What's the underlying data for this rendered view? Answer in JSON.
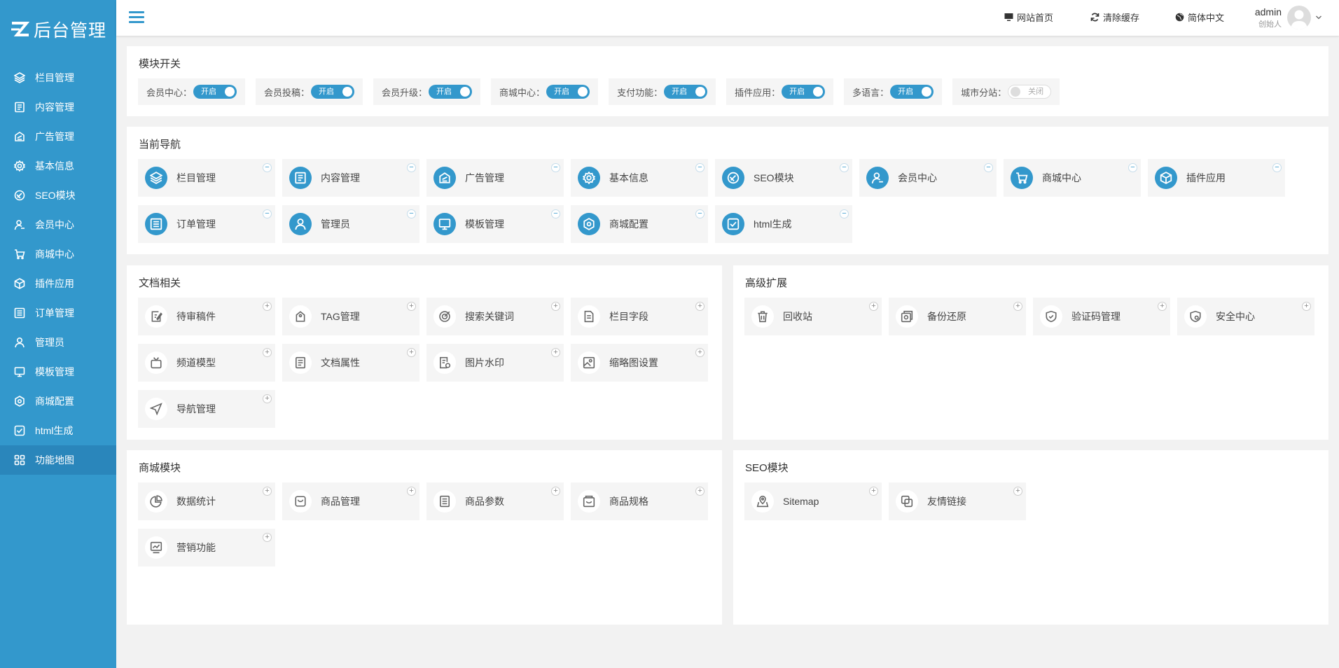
{
  "brand": {
    "logo_text": "后台管理"
  },
  "sidebar": {
    "items": [
      {
        "label": "栏目管理",
        "icon": "layers-icon"
      },
      {
        "label": "内容管理",
        "icon": "document-icon"
      },
      {
        "label": "广告管理",
        "icon": "ad-icon"
      },
      {
        "label": "基本信息",
        "icon": "gear-icon"
      },
      {
        "label": "SEO模块",
        "icon": "seo-icon"
      },
      {
        "label": "会员中心",
        "icon": "user-icon"
      },
      {
        "label": "商城中心",
        "icon": "cart-icon"
      },
      {
        "label": "插件应用",
        "icon": "cube-icon"
      },
      {
        "label": "订单管理",
        "icon": "list-icon"
      },
      {
        "label": "管理员",
        "icon": "person-icon"
      },
      {
        "label": "模板管理",
        "icon": "monitor-icon"
      },
      {
        "label": "商城配置",
        "icon": "hexagon-icon"
      },
      {
        "label": "html生成",
        "icon": "check-square-icon"
      },
      {
        "label": "功能地图",
        "icon": "grid-icon"
      }
    ],
    "active_index": 13
  },
  "header": {
    "site_home": "网站首页",
    "clear_cache": "清除缓存",
    "language": "简体中文",
    "user_name": "admin",
    "user_role": "创始人"
  },
  "module_switch": {
    "title": "模块开关",
    "items": [
      {
        "label": "会员中心：",
        "state": "开启"
      },
      {
        "label": "会员投稿：",
        "state": "开启"
      },
      {
        "label": "会员升级：",
        "state": "开启"
      },
      {
        "label": "商城中心：",
        "state": "开启"
      },
      {
        "label": "支付功能：",
        "state": "开启"
      },
      {
        "label": "插件应用：",
        "state": "开启"
      },
      {
        "label": "多语言：",
        "state": "开启"
      },
      {
        "label": "城市分站：",
        "state": "关闭"
      }
    ]
  },
  "current_nav": {
    "title": "当前导航",
    "items": [
      {
        "label": "栏目管理"
      },
      {
        "label": "内容管理"
      },
      {
        "label": "广告管理"
      },
      {
        "label": "基本信息"
      },
      {
        "label": "SEO模块"
      },
      {
        "label": "会员中心"
      },
      {
        "label": "商城中心"
      },
      {
        "label": "插件应用"
      },
      {
        "label": "订单管理"
      },
      {
        "label": "管理员"
      },
      {
        "label": "模板管理"
      },
      {
        "label": "商城配置"
      },
      {
        "label": "html生成"
      }
    ]
  },
  "docs": {
    "title": "文档相关",
    "items": [
      {
        "label": "待审稿件"
      },
      {
        "label": "TAG管理"
      },
      {
        "label": "搜索关键词"
      },
      {
        "label": "栏目字段"
      },
      {
        "label": "频道模型"
      },
      {
        "label": "文档属性"
      },
      {
        "label": "图片水印"
      },
      {
        "label": "缩略图设置"
      },
      {
        "label": "导航管理"
      }
    ]
  },
  "advanced": {
    "title": "高级扩展",
    "items": [
      {
        "label": "回收站"
      },
      {
        "label": "备份还原"
      },
      {
        "label": "验证码管理"
      },
      {
        "label": "安全中心"
      }
    ]
  },
  "shop": {
    "title": "商城模块",
    "items": [
      {
        "label": "数据统计"
      },
      {
        "label": "商品管理"
      },
      {
        "label": "商品参数"
      },
      {
        "label": "商品规格"
      },
      {
        "label": "营销功能"
      }
    ]
  },
  "seo": {
    "title": "SEO模块",
    "items": [
      {
        "label": "Sitemap"
      },
      {
        "label": "友情链接"
      }
    ]
  },
  "colors": {
    "primary": "#3398cc",
    "active": "#2a86bb",
    "bg": "#f2f2f2",
    "tile_bg": "#f5f5f5"
  }
}
